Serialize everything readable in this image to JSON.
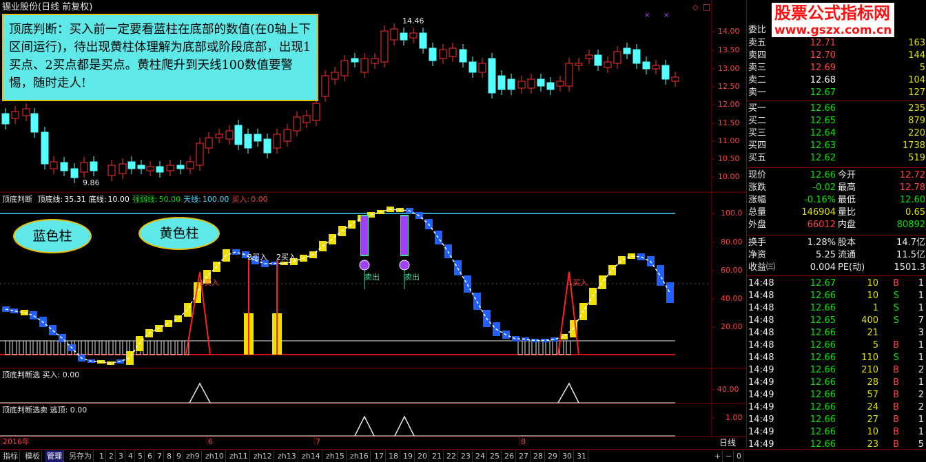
{
  "window": {
    "title": "锡业股份(日线 前复权)"
  },
  "note": {
    "text": "顶底判断：买入前一定要看蓝柱在底部的数值(在0轴上下区间运行)，待出现黄柱体理解为底部或阶段底部，出现1买点、2买点都是买点。黄柱爬升到天线100数值要警惕，随时走人!"
  },
  "bubbles": {
    "blue": "蓝色柱",
    "yellow": "黄色柱"
  },
  "watermark": {
    "line1": "股票公式指标网",
    "line2": "www.gszx.com.cn"
  },
  "price_panel": {
    "high_label": "14.46",
    "low_label": "9.86",
    "ticks": [
      "14.00",
      "13.50",
      "13.00",
      "12.50",
      "12.00",
      "11.50",
      "11.00",
      "10.50",
      "10.00"
    ]
  },
  "indicator_panel": {
    "name": "顶底判断",
    "fields": [
      {
        "label": "顶底线:",
        "value": "35.31",
        "color": "#ffffff"
      },
      {
        "label": "底线:",
        "value": "10.00",
        "color": "#ffffff"
      },
      {
        "label": "强弱线:",
        "value": "50.00",
        "color": "#00e000"
      },
      {
        "label": "天线:",
        "value": "100.00",
        "color": "#40e0ff"
      },
      {
        "label": "买入:",
        "value": "0.00",
        "color": "#ff4040"
      }
    ],
    "ticks": [
      "100.0",
      "80.00",
      "60.00",
      "40.00",
      "20.00"
    ],
    "signals": {
      "buy1": "1买入",
      "buy2": "2买入",
      "sell": "卖出"
    }
  },
  "select_panel": {
    "name": "顶底判断选",
    "field": "买入:",
    "value": "0.00",
    "tick": "40.00"
  },
  "escape_panel": {
    "name": "顶底判断选卖",
    "field": "逃顶:",
    "value": "0.00",
    "tick": "1.00"
  },
  "time_axis": {
    "labels": [
      "2016年",
      "6",
      "7",
      "8"
    ],
    "period": "日线"
  },
  "order_book": {
    "header": "委比",
    "asks": [
      {
        "label": "卖五",
        "price": "12.71",
        "vol": "163",
        "pc": "#ff4040"
      },
      {
        "label": "卖四",
        "price": "12.70",
        "vol": "144",
        "pc": "#ff4040"
      },
      {
        "label": "卖三",
        "price": "12.69",
        "vol": "5",
        "pc": "#ff4040"
      },
      {
        "label": "卖二",
        "price": "12.68",
        "vol": "104",
        "pc": "#ffffff"
      },
      {
        "label": "卖一",
        "price": "12.67",
        "vol": "127",
        "pc": "#00e000"
      }
    ],
    "bids": [
      {
        "label": "买一",
        "price": "12.66",
        "vol": "235",
        "pc": "#00e000"
      },
      {
        "label": "买二",
        "price": "12.65",
        "vol": "879",
        "pc": "#00e000"
      },
      {
        "label": "买三",
        "price": "12.64",
        "vol": "220",
        "pc": "#00e000"
      },
      {
        "label": "买四",
        "price": "12.63",
        "vol": "1738",
        "pc": "#00e000"
      },
      {
        "label": "买五",
        "price": "12.62",
        "vol": "519",
        "pc": "#00e000"
      }
    ]
  },
  "quote": [
    {
      "l1": "现价",
      "v1": "12.66",
      "c1": "#00e000",
      "l2": "今开",
      "v2": "12.72",
      "c2": "#ff4040"
    },
    {
      "l1": "涨跌",
      "v1": "-0.02",
      "c1": "#00e000",
      "l2": "最高",
      "v2": "12.78",
      "c2": "#ff4040"
    },
    {
      "l1": "涨幅",
      "v1": "-0.16%",
      "c1": "#00e000",
      "l2": "最低",
      "v2": "12.60",
      "c2": "#00e000"
    },
    {
      "l1": "总量",
      "v1": "146904",
      "c1": "#e0e000",
      "l2": "量比",
      "v2": "0.65",
      "c2": "#e0e000"
    },
    {
      "l1": "外盘",
      "v1": "66012",
      "c1": "#ff4040",
      "l2": "内盘",
      "v2": "80892",
      "c2": "#00e000"
    }
  ],
  "stats": [
    {
      "l1": "换手",
      "v1": "1.28%",
      "l2": "股本",
      "v2": "14.7亿"
    },
    {
      "l1": "净资",
      "v1": "5.25",
      "l2": "流通",
      "v2": "11.5亿"
    },
    {
      "l1": "收益㈢",
      "v1": "0.004",
      "l2": "PE(动)",
      "v2": "1501.3"
    }
  ],
  "ticks_list": [
    {
      "time": "14:48",
      "price": "12.67",
      "vol": "10",
      "side": "B",
      "n": "1"
    },
    {
      "time": "14:48",
      "price": "12.66",
      "vol": "10",
      "side": "S",
      "n": "1"
    },
    {
      "time": "14:48",
      "price": "12.66",
      "vol": "1",
      "side": "S",
      "n": "1"
    },
    {
      "time": "14:48",
      "price": "12.65",
      "vol": "400",
      "side": "S",
      "n": "7"
    },
    {
      "time": "14:48",
      "price": "12.66",
      "vol": "21",
      "side": "",
      "n": "3"
    },
    {
      "time": "14:48",
      "price": "12.66",
      "vol": "5",
      "side": "B",
      "n": "1"
    },
    {
      "time": "14:48",
      "price": "12.66",
      "vol": "110",
      "side": "S",
      "n": "1"
    },
    {
      "time": "14:49",
      "price": "12.66",
      "vol": "210",
      "side": "B",
      "n": "2"
    },
    {
      "time": "14:49",
      "price": "12.66",
      "vol": "28",
      "side": "B",
      "n": "1"
    },
    {
      "time": "14:49",
      "price": "12.66",
      "vol": "57",
      "side": "B",
      "n": "2"
    },
    {
      "time": "14:49",
      "price": "12.66",
      "vol": "24",
      "side": "B",
      "n": "2"
    },
    {
      "time": "14:49",
      "price": "12.66",
      "vol": "27",
      "side": "B",
      "n": "1"
    },
    {
      "time": "14:49",
      "price": "12.66",
      "vol": "10",
      "side": "B",
      "n": "1"
    },
    {
      "time": "14:49",
      "price": "12.66",
      "vol": "23",
      "side": "B",
      "n": "5"
    }
  ],
  "bottom_tabs": [
    "指标",
    "模板",
    "管理",
    "另存为",
    "1",
    "2",
    "3",
    "4",
    "5",
    "6",
    "7",
    "8",
    "9",
    "zh9",
    "zh10",
    "zh11",
    "zh12",
    "zh13",
    "zh14",
    "zh15",
    "zh16",
    "17",
    "18",
    "19",
    "20",
    "21",
    "22",
    "23",
    "24",
    "25",
    "26",
    "27",
    "28",
    "29",
    "30",
    "31"
  ],
  "bottom_right": [
    "+",
    "−",
    "0"
  ],
  "colors": {
    "up": "#ff3030",
    "down": "#54ffff",
    "blue_bar": "#2060ff",
    "yellow_bar": "#f0e000",
    "sky": "#40e0ff",
    "frame": "#800000"
  }
}
